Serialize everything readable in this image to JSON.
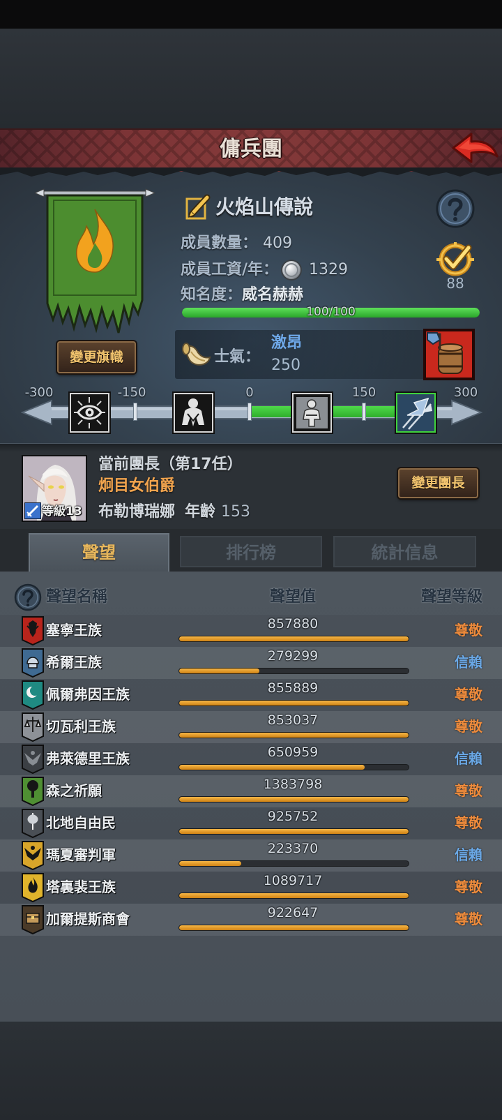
{
  "header": {
    "title": "傭兵團"
  },
  "guild": {
    "name": "火焰山傳說",
    "banner_color": "#4c8d2f",
    "banner_emblem": "flame-icon",
    "change_banner_label": "變更旗幟",
    "members_label": "成員數量：",
    "members_value": "409",
    "wage_label": "成員工資/年：",
    "wage_value": "1329",
    "fame_label": "知名度：",
    "fame_value": "威名赫赫",
    "fame_progress_text": "100/100",
    "fame_progress": 1.0,
    "badge_value": "88"
  },
  "morale": {
    "label": "士氣：",
    "status": "激昂",
    "value": 250,
    "min": -300,
    "max": 300,
    "scale_labels": [
      "-300",
      "-150",
      "0",
      "150",
      "300"
    ],
    "stage_icons": [
      "eye-icon",
      "kneeling-figure-icon",
      "seated-figure-icon",
      "war-banner-icon"
    ],
    "active_stage": 3
  },
  "leader": {
    "title": "當前團長（第17任）",
    "epithet": "炯目女伯爵",
    "name": "布勒博瑞娜",
    "age_label": "年齡",
    "age": "153",
    "level": "等級13",
    "change_label": "變更團長"
  },
  "tabs": [
    {
      "label": "聲望",
      "active": true
    },
    {
      "label": "排行榜",
      "active": false
    },
    {
      "label": "統計信息",
      "active": false
    }
  ],
  "reputation": {
    "headers": {
      "name": "聲望名稱",
      "value": "聲望值",
      "grade": "聲望等級"
    },
    "grade_colors": {
      "尊敬": "#ee8b3c",
      "信賴": "#6aa8e6"
    },
    "rows": [
      {
        "name": "塞寧王族",
        "value": "857880",
        "progress": 1.0,
        "grade": "尊敬",
        "icon": "red-beast-crest-icon",
        "icon_color": "#b8241c"
      },
      {
        "name": "希爾王族",
        "value": "279299",
        "progress": 0.35,
        "grade": "信賴",
        "icon": "blue-helm-crest-icon",
        "icon_color": "#3f6a92"
      },
      {
        "name": "佩爾弗因王族",
        "value": "855889",
        "progress": 1.0,
        "grade": "尊敬",
        "icon": "teal-moon-crest-icon",
        "icon_color": "#1f8a82"
      },
      {
        "name": "切瓦利王族",
        "value": "853037",
        "progress": 1.0,
        "grade": "尊敬",
        "icon": "scales-crest-icon",
        "icon_color": "#8d9197"
      },
      {
        "name": "弗萊德里王族",
        "value": "650959",
        "progress": 0.81,
        "grade": "信賴",
        "icon": "eagle-crest-icon",
        "icon_color": "#3b3f44"
      },
      {
        "name": "森之祈願",
        "value": "1383798",
        "progress": 1.0,
        "grade": "尊敬",
        "icon": "tree-crest-icon",
        "icon_color": "#4f8f33"
      },
      {
        "name": "北地自由民",
        "value": "925752",
        "progress": 1.0,
        "grade": "尊敬",
        "icon": "axe-crest-icon",
        "icon_color": "#4a4f55"
      },
      {
        "name": "瑪夏審判軍",
        "value": "223370",
        "progress": 0.27,
        "grade": "信賴",
        "icon": "wing-crest-icon",
        "icon_color": "#d8a52a"
      },
      {
        "name": "塔裏裴王族",
        "value": "1089717",
        "progress": 1.0,
        "grade": "尊敬",
        "icon": "flame-crest-icon",
        "icon_color": "#e0b42c"
      },
      {
        "name": "加爾提斯商會",
        "value": "922647",
        "progress": 1.0,
        "grade": "尊敬",
        "icon": "chest-crest-icon",
        "icon_color": "#4a3a28"
      }
    ]
  }
}
